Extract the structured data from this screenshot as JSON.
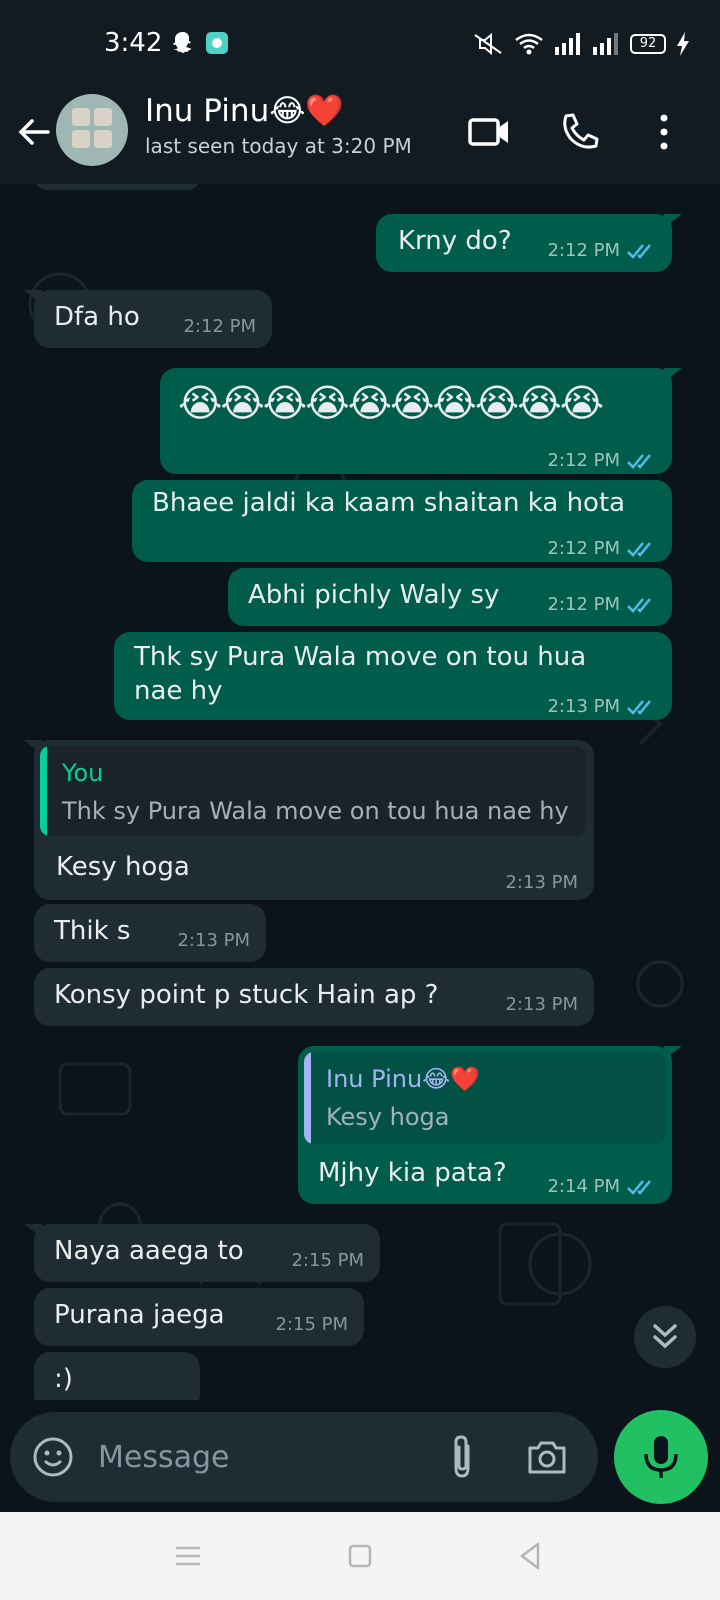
{
  "status_bar": {
    "time": "3:42",
    "battery": "92",
    "icons": [
      "snapchat-icon",
      "app-icon",
      "mute-icon",
      "wifi-icon",
      "signal-icon",
      "signal-icon",
      "battery-icon",
      "charging-icon"
    ]
  },
  "header": {
    "contact_name": "Inu Pinu😂❤️",
    "last_seen": "last seen today at 3:20 PM",
    "icons": [
      "back-arrow-icon",
      "video-call-icon",
      "voice-call-icon",
      "more-options-icon"
    ]
  },
  "messages": [
    {
      "dir": "out",
      "text": "Krny do?",
      "time": "2:12 PM",
      "status": "read"
    },
    {
      "dir": "in",
      "text": "Dfa ho",
      "time": "2:12 PM"
    },
    {
      "dir": "out",
      "text": "😭😭😭😭😭😭😭😭😭😭",
      "time": "2:12 PM",
      "status": "read"
    },
    {
      "dir": "out",
      "text": "Bhaee jaldi ka kaam shaitan ka hota",
      "time": "2:12 PM",
      "status": "read"
    },
    {
      "dir": "out",
      "text": "Abhi pichly Waly sy",
      "time": "2:12 PM",
      "status": "read"
    },
    {
      "dir": "out",
      "text_line1": "Thk sy Pura Wala move on tou hua",
      "text_line2": "nae hy",
      "time": "2:13 PM",
      "status": "read"
    },
    {
      "dir": "in",
      "quote_name": "You",
      "quote_text": "Thk sy Pura Wala move on tou hua nae hy",
      "text": "Kesy hoga",
      "time": "2:13 PM"
    },
    {
      "dir": "in",
      "text": "Thik s",
      "time": "2:13 PM"
    },
    {
      "dir": "in",
      "text": "Konsy point p stuck Hain ap ?",
      "time": "2:13 PM"
    },
    {
      "dir": "out",
      "quote_name": "Inu Pinu😂❤️",
      "quote_text": "Kesy hoga",
      "text": "Mjhy kia pata?",
      "time": "2:14 PM",
      "status": "read"
    },
    {
      "dir": "in",
      "text": "Naya aaega to",
      "time": "2:15 PM"
    },
    {
      "dir": "in",
      "text": "Purana jaega",
      "time": "2:15 PM"
    },
    {
      "dir": "in",
      "text": ":)",
      "time": ""
    }
  ],
  "composer": {
    "placeholder": "Message",
    "icons": [
      "emoji-icon",
      "attach-icon",
      "camera-icon",
      "mic-icon"
    ]
  },
  "colors": {
    "outgoing_bubble": "#005c4b",
    "incoming_bubble": "#202c33",
    "background": "#0b141a",
    "accent_green": "#21c063",
    "read_tick": "#53bdeb",
    "quote_you": "#06cf9c",
    "quote_contact": "#a5b3f7"
  }
}
